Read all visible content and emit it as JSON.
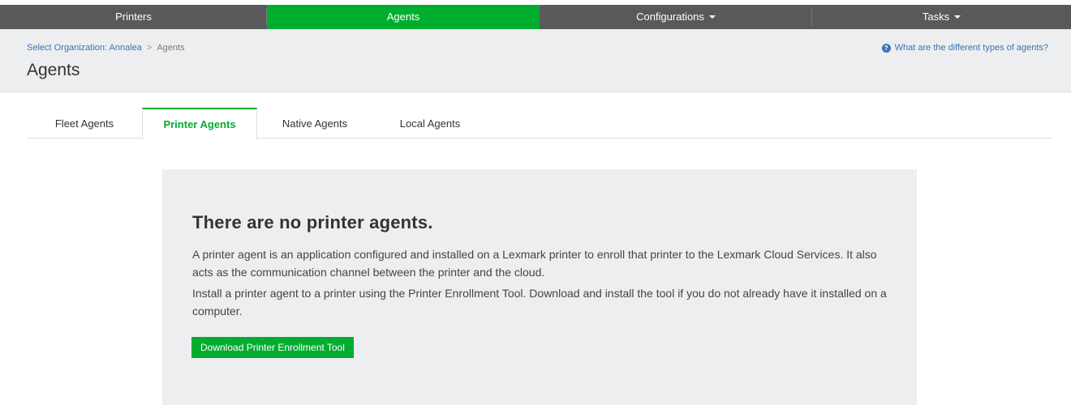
{
  "nav": {
    "items": [
      {
        "label": "Printers",
        "active": false,
        "dropdown": false
      },
      {
        "label": "Agents",
        "active": true,
        "dropdown": false
      },
      {
        "label": "Configurations",
        "active": false,
        "dropdown": true
      },
      {
        "label": "Tasks",
        "active": false,
        "dropdown": true
      }
    ]
  },
  "breadcrumb": {
    "org_link": "Select Organization: Annalea",
    "separator": ">",
    "current": "Agents"
  },
  "header": {
    "title": "Agents",
    "help_link": "What are the different types of agents?",
    "help_icon": "question-circle-icon"
  },
  "tabs": [
    {
      "label": "Fleet Agents",
      "active": false
    },
    {
      "label": "Printer Agents",
      "active": true
    },
    {
      "label": "Native Agents",
      "active": false
    },
    {
      "label": "Local Agents",
      "active": false
    }
  ],
  "empty_state": {
    "title": "There are no printer agents.",
    "paragraph1": "A printer agent is an application configured and installed on a Lexmark printer to enroll that printer to the Lexmark Cloud Services. It also acts as the communication channel between the printer and the cloud.",
    "paragraph2": "Install a printer agent to a printer using the Printer Enrollment Tool. Download and install the tool if you do not already have it installed on a computer.",
    "button_label": "Download Printer Enrollment Tool"
  },
  "colors": {
    "accent_green": "#00ad2f",
    "nav_bg": "#58595b",
    "header_bg": "#edeef0",
    "link_blue": "#3b73b9"
  }
}
